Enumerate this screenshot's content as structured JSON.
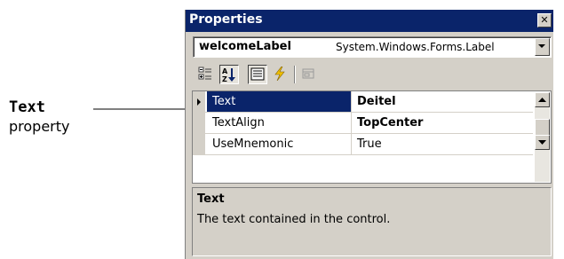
{
  "callout": {
    "title": "Text",
    "subtitle": "property"
  },
  "window": {
    "title": "Properties",
    "close_glyph": "✕"
  },
  "object_selector": {
    "name": "welcomeLabel",
    "type": "System.Windows.Forms.Label"
  },
  "toolbar": {
    "buttons": [
      {
        "icon": "categorized-icon",
        "pressed": false
      },
      {
        "icon": "alphabetical-icon",
        "pressed": true
      },
      {
        "icon": "properties-icon",
        "pressed": true
      },
      {
        "icon": "events-icon",
        "pressed": false
      },
      {
        "icon": "property-pages-icon",
        "pressed": false
      }
    ]
  },
  "grid": {
    "rows": [
      {
        "name": "Text",
        "value": "Deitel",
        "bold": true,
        "selected": true
      },
      {
        "name": "TextAlign",
        "value": "TopCenter",
        "bold": true,
        "selected": false
      },
      {
        "name": "UseMnemonic",
        "value": "True",
        "bold": false,
        "selected": false
      }
    ]
  },
  "description": {
    "title": "Text",
    "text": "The text contained in the control."
  },
  "colors": {
    "titlebar": "#0a246a",
    "selection": "#0a246a",
    "chrome": "#d4d0c8"
  }
}
